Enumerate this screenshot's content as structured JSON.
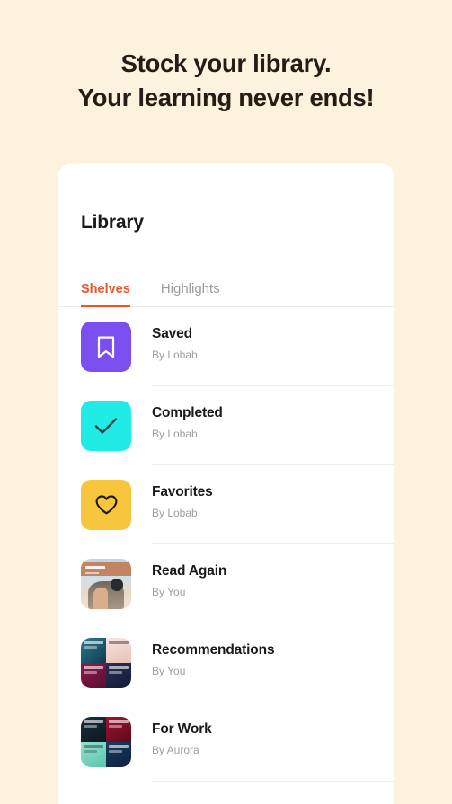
{
  "hero": {
    "line1": "Stock your library.",
    "line2": "Your learning never ends!"
  },
  "card": {
    "title": "Library",
    "tabs": [
      {
        "label": "Shelves",
        "active": true
      },
      {
        "label": "Highlights",
        "active": false
      }
    ],
    "shelves": [
      {
        "title": "Saved",
        "byline": "By Lobab",
        "icon": "bookmark-icon",
        "icon_bg": "#7B4EF0",
        "icon_fg": "#FFFFFF",
        "thumb_type": "icon"
      },
      {
        "title": "Completed",
        "byline": "By Lobab",
        "icon": "check-icon",
        "icon_bg": "#20ECE5",
        "icon_fg": "#2B3A3E",
        "thumb_type": "icon"
      },
      {
        "title": "Favorites",
        "byline": "By Lobab",
        "icon": "heart-icon",
        "icon_bg": "#F7C63D",
        "icon_fg": "#1A1A1A",
        "thumb_type": "icon"
      },
      {
        "title": "Read Again",
        "byline": "By You",
        "icon": "photo-thumbnail",
        "thumb_type": "photo"
      },
      {
        "title": "Recommendations",
        "byline": "By You",
        "icon": "collage-thumbnail",
        "thumb_type": "collage",
        "tiles": [
          "#1F5B72",
          "#F3D9D6",
          "#7E1640",
          "#1B2140"
        ]
      },
      {
        "title": "For Work",
        "byline": "By Aurora",
        "icon": "collage-thumbnail",
        "thumb_type": "collage",
        "tiles": [
          "#12242F",
          "#8C1028",
          "#7EDCC8",
          "#8A5B2E",
          "#1C3A5E"
        ]
      }
    ]
  },
  "colors": {
    "page_bg": "#FDF2DD",
    "card_bg": "#FFFFFF",
    "accent": "#E8552D",
    "heading": "#241C15",
    "muted": "#9E9E9E",
    "divider": "#EDEDED"
  }
}
